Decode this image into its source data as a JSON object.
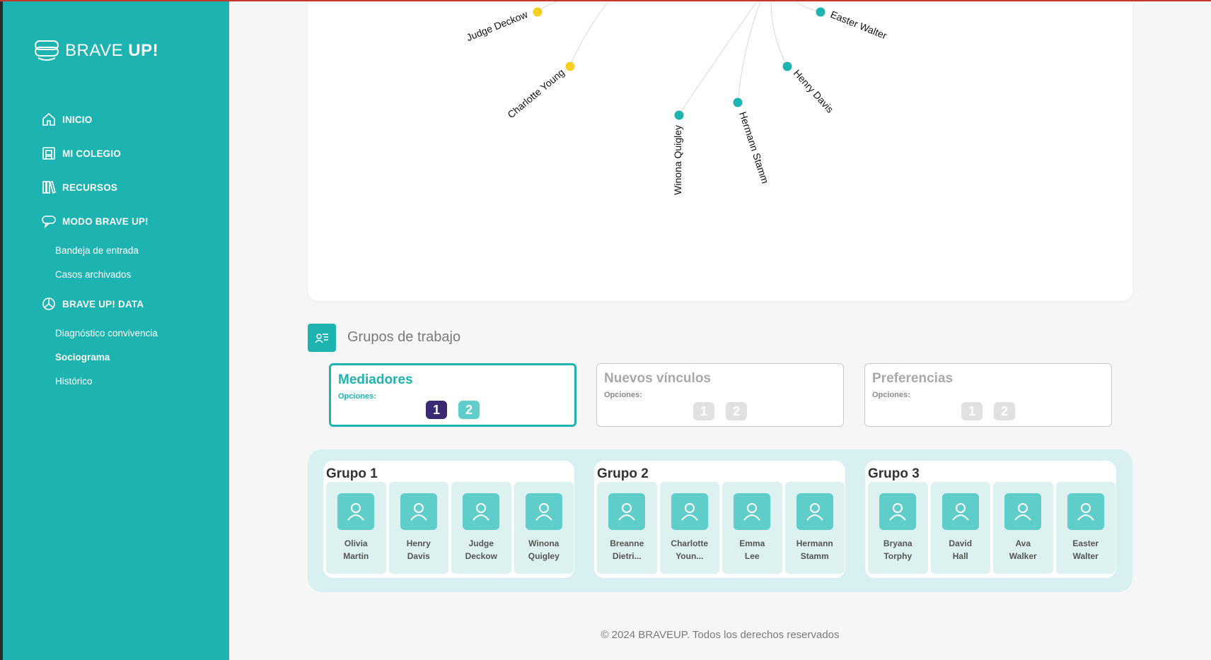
{
  "brand": {
    "light": "BRAVE ",
    "bold": "UP!"
  },
  "sidebar": {
    "items": [
      {
        "label": "INICIO",
        "icon": "home-icon"
      },
      {
        "label": "MI COLEGIO",
        "icon": "school-icon"
      },
      {
        "label": "RECURSOS",
        "icon": "books-icon"
      },
      {
        "label": "MODO BRAVE UP!",
        "icon": "chat-icon"
      },
      {
        "label": "BRAVE UP! DATA",
        "icon": "pie-chart-icon"
      }
    ],
    "subitems": [
      {
        "label": "Bandeja de entrada"
      },
      {
        "label": "Casos archivados"
      },
      {
        "label": "Diagnóstico convivencia"
      },
      {
        "label": "Sociograma",
        "active": true
      },
      {
        "label": "Histórico"
      }
    ]
  },
  "sociogram": {
    "node_labels": [
      "Judge Deckow",
      "Easter Walter",
      "Charlotte Young",
      "Henry Davis",
      "Winona Quigley",
      "Hermann Stamm"
    ],
    "colors": {
      "teal": "#1db3b0",
      "yellow": "#f5d020"
    }
  },
  "section": {
    "title": "Grupos de trabajo"
  },
  "options": [
    {
      "title": "Mediadores",
      "subtitle": "Opciones:",
      "nums": [
        "1",
        "2"
      ],
      "active": true
    },
    {
      "title": "Nuevos vínculos",
      "subtitle": "Opciones:",
      "nums": [
        "1",
        "2"
      ],
      "active": false
    },
    {
      "title": "Preferencias",
      "subtitle": "Opciones:",
      "nums": [
        "1",
        "2"
      ],
      "active": false
    }
  ],
  "groups": [
    {
      "title": "Grupo 1",
      "members": [
        {
          "first": "Olivia",
          "last": "Martin"
        },
        {
          "first": "Henry",
          "last": "Davis"
        },
        {
          "first": "Judge",
          "last": "Deckow"
        },
        {
          "first": "Winona",
          "last": "Quigley"
        }
      ]
    },
    {
      "title": "Grupo 2",
      "members": [
        {
          "first": "Breanne",
          "last": "Dietri..."
        },
        {
          "first": "Charlotte",
          "last": "Youn..."
        },
        {
          "first": "Emma",
          "last": "Lee"
        },
        {
          "first": "Hermann",
          "last": "Stamm"
        }
      ]
    },
    {
      "title": "Grupo 3",
      "members": [
        {
          "first": "Bryana",
          "last": "Torphy"
        },
        {
          "first": "David",
          "last": "Hall"
        },
        {
          "first": "Ava",
          "last": "Walker"
        },
        {
          "first": "Easter",
          "last": "Walter"
        }
      ]
    }
  ],
  "footer": {
    "text": "© 2024 BRAVEUP. Todos los derechos reservados"
  },
  "theme": {
    "accent": "#1db3b0",
    "selected_badge": "#3a2a73",
    "light_teal": "#5fcdca"
  }
}
